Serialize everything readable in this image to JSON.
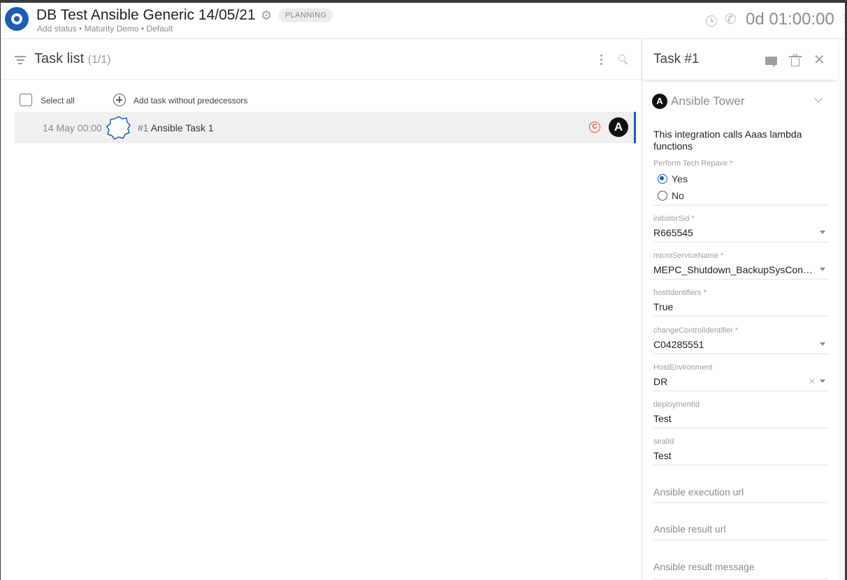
{
  "header": {
    "title": "DB Test Ansible Generic 14/05/21",
    "status_badge": "PLANNING",
    "subtitle": "Add status • Maturity Demo • Default",
    "timer": "0d 01:00:00",
    "icons": [
      "app-logo-icon",
      "gear-icon",
      "clock-icon",
      "phone-icon"
    ]
  },
  "task_list": {
    "title": "Task list",
    "count": "(1/1)",
    "select_all_label": "Select all",
    "add_task_label": "Add task without predecessors",
    "tasks": [
      {
        "date": "14 May 00:00",
        "number": "#1",
        "name": "Ansible Task 1",
        "status_icon": "c-circle-icon",
        "integration_icon": "ansible-icon"
      }
    ]
  },
  "task_panel": {
    "title": "Task #1",
    "integration": {
      "logo_letter": "A",
      "name": "Ansible Tower",
      "description": "This integration calls Aaas lambda functions"
    },
    "perform_tech_repave": {
      "label": "Perform Tech Repave *",
      "options": [
        "Yes",
        "No"
      ],
      "selected": "Yes"
    },
    "fields": [
      {
        "label": "initiatorSid *",
        "value": "R665545",
        "type": "dropdown"
      },
      {
        "label": "microServiceName *",
        "value": "MEPC_Shutdown_BackupSysCon…",
        "type": "dropdown"
      },
      {
        "label": "hostIdentifiers *",
        "value": "True",
        "type": "text"
      },
      {
        "label": "changeControlIdentifier *",
        "value": "C04285551",
        "type": "dropdown"
      },
      {
        "label": "HostEnvironment",
        "value": "DR",
        "type": "dropdown-clearable"
      },
      {
        "label": "deploymentId",
        "value": "Test",
        "type": "text"
      },
      {
        "label": "sealId",
        "value": "Test",
        "type": "text"
      }
    ],
    "placeholder_fields": [
      "Ansible execution url",
      "Ansible result url",
      "Ansible result message"
    ]
  },
  "colors": {
    "accent": "#1e5bb8",
    "status_red": "#f44336",
    "badge_bg": "#ececec"
  }
}
